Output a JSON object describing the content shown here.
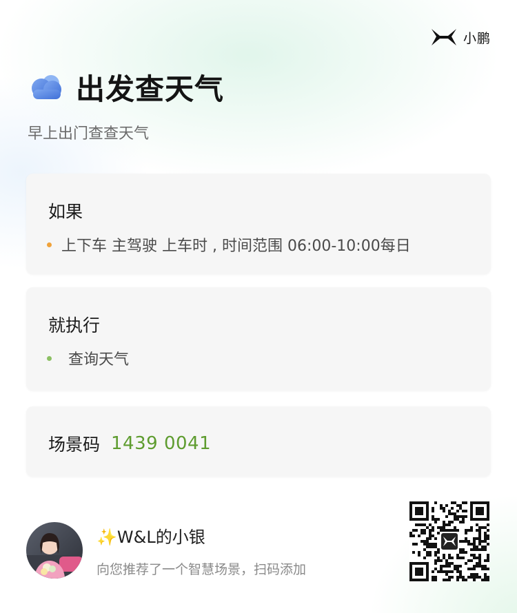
{
  "brand": {
    "name": "小鹏",
    "logo_icon": "xpeng-x-logo-icon"
  },
  "header": {
    "icon": "cloud-icon",
    "title": "出发查天气",
    "subtitle": "早上出门查查天气"
  },
  "condition_card": {
    "heading": "如果",
    "bullet_color": "#f0a23a",
    "item": "上下车 主驾驶 上车时 , 时间范围 06:00-10:00每日"
  },
  "action_card": {
    "heading": "就执行",
    "bullet_color": "#8cc063",
    "item": "查询天气"
  },
  "code_card": {
    "label": "场景码",
    "value": "1439 0041",
    "value_color": "#5e9c2f"
  },
  "footer": {
    "avatar": "user-avatar-photo",
    "user_name": "✨W&L的小银",
    "share_text": "向您推荐了一个智慧场景，扫码添加",
    "qr_icon": "qr-code-icon"
  }
}
